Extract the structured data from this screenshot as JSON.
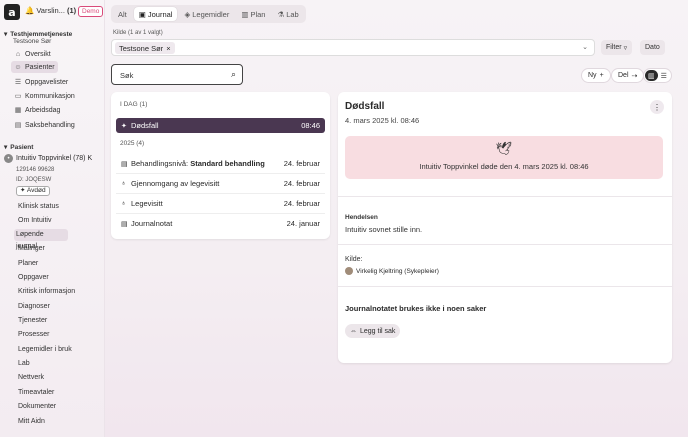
{
  "topbar": {
    "logo": "a",
    "alert_label": "Varslin...",
    "alert_count": "(1)",
    "demo_badge": "Demo"
  },
  "sidebar": {
    "unit_title": "Testhjemmetjeneste",
    "unit_sub": "Testsone Sør",
    "items": [
      {
        "label": "Oversikt",
        "icon": "home-icon"
      },
      {
        "label": "Pasienter",
        "icon": "people-icon"
      },
      {
        "label": "Oppgavelister",
        "icon": "list-icon"
      },
      {
        "label": "Kommunikasjon",
        "icon": "chat-icon"
      },
      {
        "label": "Arbeidsdag",
        "icon": "calendar-icon"
      },
      {
        "label": "Saksbehandling",
        "icon": "folder-icon"
      }
    ],
    "patient_section": "Pasient",
    "patient_name": "Intuitiv Toppvinkel (78) K",
    "patient_id": "129146 99628",
    "patient_code": "ID: JOQESW",
    "deceased_label": "Avdød",
    "patient_nav": [
      "Klinisk status",
      "Om Intuitiv",
      "Løpende journal",
      "Målinger",
      "Planer",
      "Oppgaver",
      "Kritisk informasjon",
      "Diagnoser",
      "Tjenester",
      "Prosesser",
      "Legemidler i bruk",
      "Lab",
      "Nettverk",
      "Timeavtaler",
      "Dokumenter",
      "Mitt Aidn"
    ]
  },
  "tabs": [
    {
      "label": "Alt",
      "icon": ""
    },
    {
      "label": "Journal",
      "icon": "journal-icon"
    },
    {
      "label": "Legemidler",
      "icon": "pill-icon"
    },
    {
      "label": "Plan",
      "icon": "plan-icon"
    },
    {
      "label": "Lab",
      "icon": "flask-icon"
    }
  ],
  "filters": {
    "kilde_label": "Kilde (1 av 1 valgt)",
    "kilde_chip": "Testsone Sør",
    "filter_label": "Filter",
    "dato_label": "Dato"
  },
  "search": {
    "placeholder": "Søk"
  },
  "actions": {
    "new_label": "Ny",
    "share_label": "Del"
  },
  "list": {
    "today_header": "I DAG (1)",
    "year_header": "2025 (4)",
    "today_items": [
      {
        "title": "Dødsfall",
        "date": "08:46",
        "icon": "dove-icon"
      }
    ],
    "year_items": [
      {
        "title_prefix": "Behandlingsnivå: ",
        "title_bold": "Standard behandling",
        "date": "24. februar",
        "icon": "doc-icon"
      },
      {
        "title_prefix": "Gjennomgang av legevisitt",
        "title_bold": "",
        "date": "24. februar",
        "icon": "stethoscope-icon"
      },
      {
        "title_prefix": "Legevisitt",
        "title_bold": "",
        "date": "24. februar",
        "icon": "stethoscope-icon"
      },
      {
        "title_prefix": "Journalnotat",
        "title_bold": "",
        "date": "24. januar",
        "icon": "doc-icon"
      }
    ]
  },
  "detail": {
    "title": "Dødsfall",
    "date": "4. mars 2025 kl. 08:46",
    "death_text": "Intuitiv Toppvinkel døde den 4. mars 2025 kl. 08:46",
    "event_heading": "Hendelsen",
    "event_text": "Intuitiv sovnet stille inn.",
    "source_heading": "Kilde:",
    "source_person": "Virkelig Kjeltring (Sykepleier)",
    "cases_heading": "Journalnotatet brukes ikke i noen saker",
    "add_case_label": "Legg til sak"
  },
  "colors": {
    "accent": "#4a3751",
    "death_bg": "#f8dde1",
    "demo": "#d94a7a"
  }
}
